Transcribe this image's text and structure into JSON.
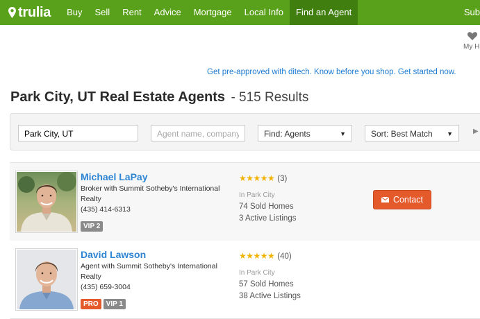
{
  "nav": {
    "logo": "trulia",
    "items": [
      "Buy",
      "Sell",
      "Rent",
      "Advice",
      "Mortgage",
      "Local Info",
      "Find an Agent"
    ],
    "active_index": 6,
    "overflow_label": "Sub"
  },
  "my_homes_label": "My H",
  "promo_text": "Get pre-approved with ditech. Know before you shop. Get started now.",
  "heading": {
    "title": "Park City, UT Real Estate Agents",
    "results": "- 515 Results"
  },
  "filters": {
    "location_value": "Park City, UT",
    "agent_placeholder": "Agent name, company",
    "find_label": "Find: Agents",
    "sort_label": "Sort: Best Match"
  },
  "agents": [
    {
      "name": "Michael LaPay",
      "title": "Broker with Summit Sotheby's International Realty",
      "phone": "(435) 414-6313",
      "badges": [
        "VIP 2"
      ],
      "stars": "★★★★★",
      "rating": 5,
      "review_count": "(3)",
      "location": "In Park City",
      "sold": "74 Sold Homes",
      "active": "3 Active Listings",
      "contact_label": "Contact"
    },
    {
      "name": "David Lawson",
      "title": "Agent with Summit Sotheby's International Realty",
      "phone": "(435) 659-3004",
      "badges": [
        "PRO",
        "VIP 1"
      ],
      "stars": "★★★★★",
      "rating": 5,
      "review_count": "(40)",
      "location": "In Park City",
      "sold": "57 Sold Homes",
      "active": "38 Active Listings"
    }
  ],
  "colors": {
    "brand_green": "#5aa11b",
    "active_nav": "#3f7e0f",
    "link_blue": "#2c84d3",
    "contact_orange": "#e55a2b",
    "star_gold": "#f0b400"
  },
  "icons": [
    "map-pin-icon",
    "heart-icon",
    "dropdown-arrow-icon",
    "play-arrow-icon",
    "envelope-icon"
  ]
}
